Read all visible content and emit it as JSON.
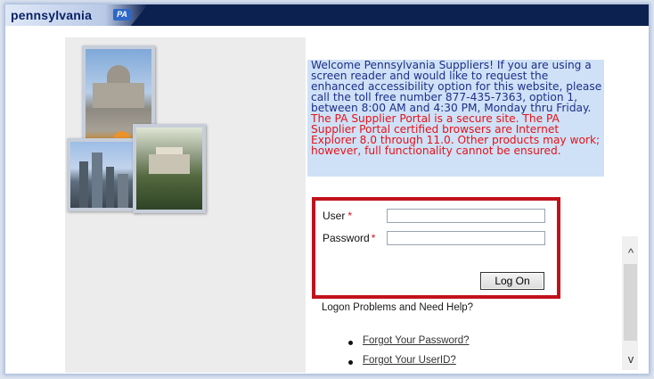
{
  "header": {
    "brand": "pennsylvania",
    "badge": "PA"
  },
  "welcome": {
    "intro": "Welcome Pennsylvania Suppliers! If you are using a screen reader and would like to request the enhanced accessibility option for this website, please call the toll free number 877-435-7363, option 1, between 8:00 AM and 4:30 PM, Monday thru Friday.",
    "notice": "The PA Supplier Portal is a secure site. The PA Supplier Portal certified browsers are Internet Explorer 8.0 through 11.0. Other products may work; however, full functionality cannot be ensured."
  },
  "login": {
    "user_label": "User",
    "password_label": "Password",
    "required_mark": "*",
    "user_value": "",
    "password_value": "",
    "logon_button": "Log On"
  },
  "help": {
    "title": "Logon Problems and Need Help?",
    "links": [
      "Forgot Your Password?",
      "Forgot Your UserID?"
    ]
  },
  "scroll": {
    "up_glyph": "^",
    "down_glyph": "v"
  },
  "colors": {
    "header_bg": "#0d2150",
    "welcome_bg": "#cfe1f6",
    "notice_text": "#e5131a",
    "highlight_border": "#c1121c"
  }
}
